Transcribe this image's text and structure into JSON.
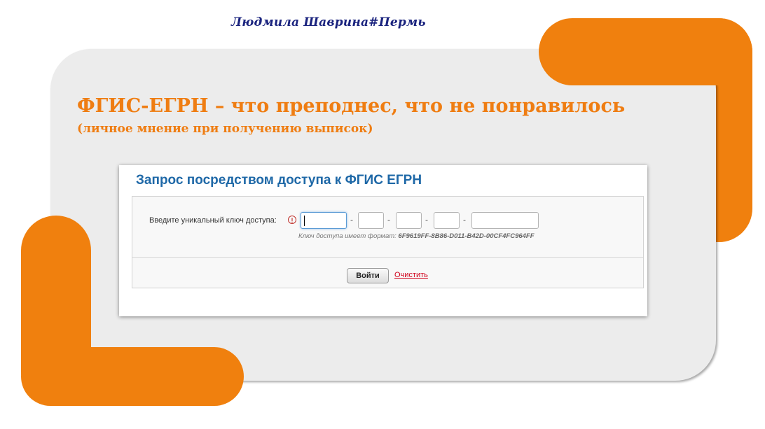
{
  "signature": "Людмила Шаврина#Пермь",
  "slide": {
    "title": "ФГИС-ЕГРН – что преподнес, что не понравилось",
    "subtitle": "(личное мнение при получению выписок)"
  },
  "form": {
    "title": "Запрос посредством доступа к ФГИС ЕГРН",
    "key_label": "Введите уникальный ключ доступа:",
    "info_icon": "!",
    "separator": "-",
    "hint_prefix": "Ключ доступа имеет формат: ",
    "hint_format": "6F9619FF-8B86-D011-B42D-00CF4FC964FF",
    "submit_label": "Войти",
    "clear_label": "Очистить"
  },
  "colors": {
    "accent_orange": "#f0800e",
    "form_title_blue": "#1e68a7",
    "link_red": "#d0021b"
  }
}
